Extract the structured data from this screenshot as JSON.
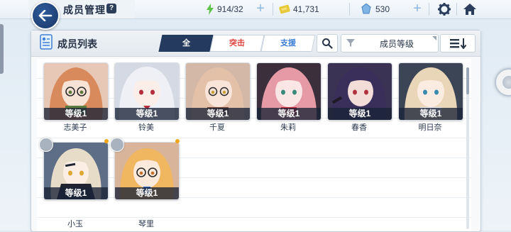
{
  "header": {
    "title": "成员管理",
    "help_label": "?",
    "stamina": "914/32",
    "credits": "41,731",
    "gems": "530"
  },
  "panel": {
    "title": "成员列表",
    "tabs": [
      {
        "label": "全",
        "active": true
      },
      {
        "label": "突击",
        "active": false
      },
      {
        "label": "支援",
        "active": false
      }
    ],
    "sort_label": "成员等级"
  },
  "members": [
    {
      "name": "志美子",
      "level": "等级1",
      "hair": "#d98a5c",
      "bg": "#e7c8b6",
      "accent": "#5b7a3d"
    },
    {
      "name": "铃美",
      "level": "等级1",
      "hair": "#eef0f5",
      "bg": "#d5d9e4",
      "accent": "#b62c3a"
    },
    {
      "name": "千夏",
      "level": "等级1",
      "hair": "#e2c1a8",
      "bg": "#d3b7a7",
      "accent": "#7a4a3a"
    },
    {
      "name": "朱莉",
      "level": "等级1",
      "hair": "#e59aa6",
      "bg": "#3a2f3a",
      "accent": "#c8303e"
    },
    {
      "name": "春香",
      "level": "等级1",
      "hair": "#3a2f5a",
      "bg": "#3b3353",
      "accent": "#b0303e"
    },
    {
      "name": "明日奈",
      "level": "等级1",
      "hair": "#e9d6b8",
      "bg": "#3c4556",
      "accent": "#e8e8ee"
    },
    {
      "name": "小玉",
      "level": "等级1",
      "hair": "#e7dcc8",
      "bg": "#5e6e86",
      "accent": "#e0a830"
    },
    {
      "name": "琴里",
      "level": "等级1",
      "hair": "#f0b760",
      "bg": "#d8b49a",
      "accent": "#3a6cc8"
    }
  ],
  "icons": {
    "back": "arrow-left-icon",
    "stamina": "lightning-icon",
    "credits": "ticket-icon",
    "gems": "crystal-icon",
    "settings": "gear-icon",
    "home": "home-icon",
    "search": "search-icon",
    "filter": "filter-icon",
    "order": "sort-order-icon",
    "pin": "pin-icon"
  }
}
